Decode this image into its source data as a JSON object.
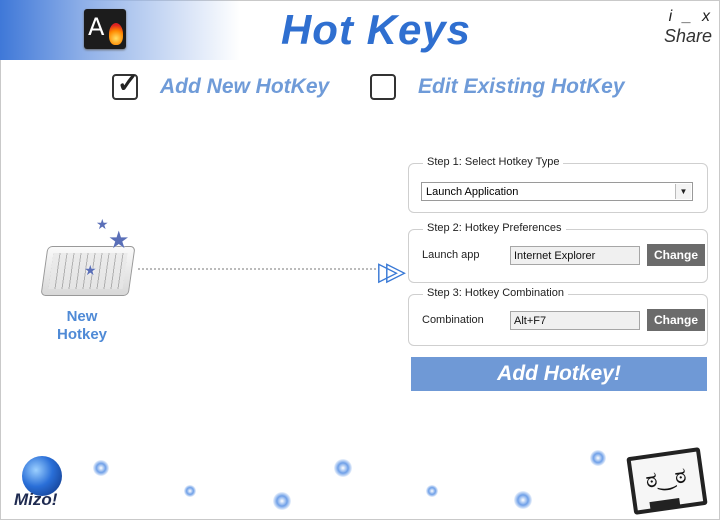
{
  "header": {
    "title": "Hot Keys",
    "app_icon_letter": "A",
    "info_label": "i",
    "minimize_label": "_",
    "close_label": "x",
    "share_label": "Share"
  },
  "tabs": [
    {
      "label": "Add New HotKey",
      "checked": true
    },
    {
      "label": "Edit Existing HotKey",
      "checked": false
    }
  ],
  "check_glyph": "✓",
  "left_panel": {
    "label_line1": "New",
    "label_line2": "Hotkey",
    "arrows": "▷▷"
  },
  "step1": {
    "title": "Step 1: Select Hotkey Type",
    "selected": "Launch Application",
    "dropdown_glyph": "▼"
  },
  "step2": {
    "title": "Step 2: Hotkey Preferences",
    "label": "Launch app",
    "value": "Internet Explorer",
    "button": "Change"
  },
  "step3": {
    "title": "Step 3: Hotkey Combination",
    "label": "Combination",
    "value": "Alt+F7",
    "button": "Change"
  },
  "add_button": "Add Hotkey!",
  "footer": {
    "brand": "Mizo!",
    "monitor_face": "ಠ‿ಠ"
  },
  "colors": {
    "title_blue": "#2f6fd0",
    "tab_blue": "#6f9bd8",
    "button_gray": "#6b6b6b",
    "add_button_blue": "#6f99d6"
  }
}
